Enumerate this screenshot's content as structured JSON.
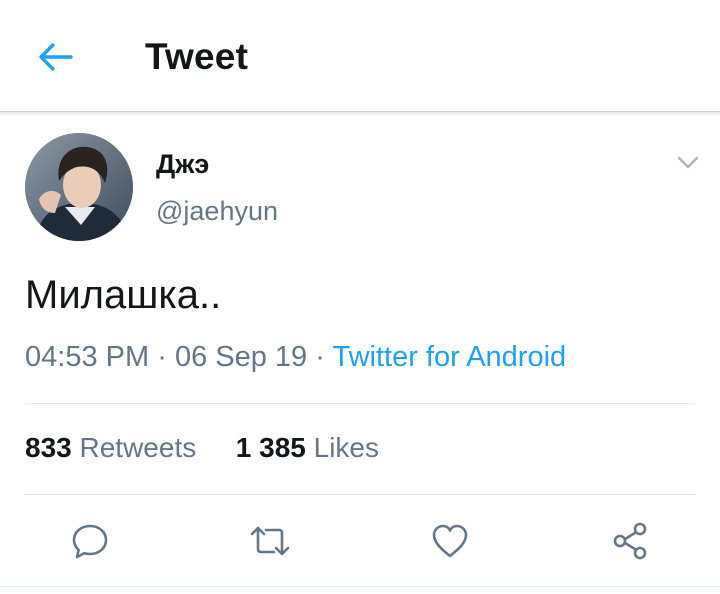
{
  "header": {
    "title": "Tweet",
    "back_icon": "arrow-left-icon",
    "accent_color": "#1da1f2"
  },
  "tweet": {
    "author": {
      "display_name": "Джэ",
      "handle": "@jaehyun"
    },
    "text": "Милашка..",
    "time": "04:53 PM",
    "date": "06 Sep 19",
    "separator": "·",
    "source": "Twitter for Android",
    "stats": {
      "retweets_count": "833",
      "retweets_label": "Retweets",
      "likes_count": "1 385",
      "likes_label": "Likes"
    }
  },
  "actions": [
    {
      "name": "reply",
      "icon": "speech-bubble-icon"
    },
    {
      "name": "retweet",
      "icon": "retweet-arrows-icon"
    },
    {
      "name": "like",
      "icon": "heart-icon"
    },
    {
      "name": "share",
      "icon": "share-nodes-icon"
    }
  ]
}
